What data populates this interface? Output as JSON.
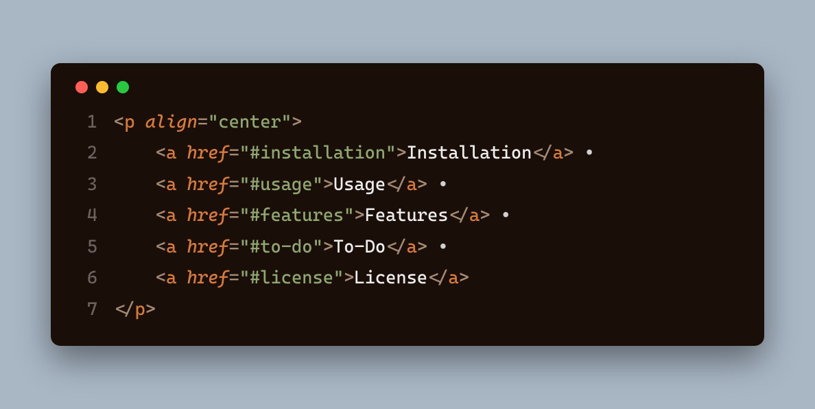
{
  "lines": [
    {
      "n": "1",
      "indent": 0,
      "segments": [
        {
          "cls": "tok-bracket",
          "t": "<"
        },
        {
          "cls": "tok-tag",
          "t": "p"
        },
        {
          "cls": "tok-text",
          "t": " "
        },
        {
          "cls": "tok-attr",
          "t": "align"
        },
        {
          "cls": "tok-eq",
          "t": "="
        },
        {
          "cls": "tok-str",
          "t": "\"center\""
        },
        {
          "cls": "tok-bracket",
          "t": ">"
        }
      ]
    },
    {
      "n": "2",
      "indent": 1,
      "segments": [
        {
          "cls": "tok-bracket",
          "t": "<"
        },
        {
          "cls": "tok-tag",
          "t": "a"
        },
        {
          "cls": "tok-text",
          "t": " "
        },
        {
          "cls": "tok-attr",
          "t": "href"
        },
        {
          "cls": "tok-eq",
          "t": "="
        },
        {
          "cls": "tok-str",
          "t": "\"#installation\""
        },
        {
          "cls": "tok-bracket",
          "t": ">"
        },
        {
          "cls": "tok-text",
          "t": "Installation"
        },
        {
          "cls": "tok-bracket",
          "t": "</"
        },
        {
          "cls": "tok-tag",
          "t": "a"
        },
        {
          "cls": "tok-bracket",
          "t": ">"
        },
        {
          "cls": "tok-bullet",
          "t": " •"
        }
      ]
    },
    {
      "n": "3",
      "indent": 1,
      "segments": [
        {
          "cls": "tok-bracket",
          "t": "<"
        },
        {
          "cls": "tok-tag",
          "t": "a"
        },
        {
          "cls": "tok-text",
          "t": " "
        },
        {
          "cls": "tok-attr",
          "t": "href"
        },
        {
          "cls": "tok-eq",
          "t": "="
        },
        {
          "cls": "tok-str",
          "t": "\"#usage\""
        },
        {
          "cls": "tok-bracket",
          "t": ">"
        },
        {
          "cls": "tok-text",
          "t": "Usage"
        },
        {
          "cls": "tok-bracket",
          "t": "</"
        },
        {
          "cls": "tok-tag",
          "t": "a"
        },
        {
          "cls": "tok-bracket",
          "t": ">"
        },
        {
          "cls": "tok-bullet",
          "t": " •"
        }
      ]
    },
    {
      "n": "4",
      "indent": 1,
      "segments": [
        {
          "cls": "tok-bracket",
          "t": "<"
        },
        {
          "cls": "tok-tag",
          "t": "a"
        },
        {
          "cls": "tok-text",
          "t": " "
        },
        {
          "cls": "tok-attr",
          "t": "href"
        },
        {
          "cls": "tok-eq",
          "t": "="
        },
        {
          "cls": "tok-str",
          "t": "\"#features\""
        },
        {
          "cls": "tok-bracket",
          "t": ">"
        },
        {
          "cls": "tok-text",
          "t": "Features"
        },
        {
          "cls": "tok-bracket",
          "t": "</"
        },
        {
          "cls": "tok-tag",
          "t": "a"
        },
        {
          "cls": "tok-bracket",
          "t": ">"
        },
        {
          "cls": "tok-bullet",
          "t": " •"
        }
      ]
    },
    {
      "n": "5",
      "indent": 1,
      "segments": [
        {
          "cls": "tok-bracket",
          "t": "<"
        },
        {
          "cls": "tok-tag",
          "t": "a"
        },
        {
          "cls": "tok-text",
          "t": " "
        },
        {
          "cls": "tok-attr",
          "t": "href"
        },
        {
          "cls": "tok-eq",
          "t": "="
        },
        {
          "cls": "tok-str",
          "t": "\"#to-do\""
        },
        {
          "cls": "tok-bracket",
          "t": ">"
        },
        {
          "cls": "tok-text",
          "t": "To-Do"
        },
        {
          "cls": "tok-bracket",
          "t": "</"
        },
        {
          "cls": "tok-tag",
          "t": "a"
        },
        {
          "cls": "tok-bracket",
          "t": ">"
        },
        {
          "cls": "tok-bullet",
          "t": " •"
        }
      ]
    },
    {
      "n": "6",
      "indent": 1,
      "segments": [
        {
          "cls": "tok-bracket",
          "t": "<"
        },
        {
          "cls": "tok-tag",
          "t": "a"
        },
        {
          "cls": "tok-text",
          "t": " "
        },
        {
          "cls": "tok-attr",
          "t": "href"
        },
        {
          "cls": "tok-eq",
          "t": "="
        },
        {
          "cls": "tok-str",
          "t": "\"#license\""
        },
        {
          "cls": "tok-bracket",
          "t": ">"
        },
        {
          "cls": "tok-text",
          "t": "License"
        },
        {
          "cls": "tok-bracket",
          "t": "</"
        },
        {
          "cls": "tok-tag",
          "t": "a"
        },
        {
          "cls": "tok-bracket",
          "t": ">"
        }
      ]
    },
    {
      "n": "7",
      "indent": 0,
      "segments": [
        {
          "cls": "tok-bracket",
          "t": "</"
        },
        {
          "cls": "tok-tag",
          "t": "p"
        },
        {
          "cls": "tok-bracket",
          "t": ">"
        }
      ]
    }
  ]
}
